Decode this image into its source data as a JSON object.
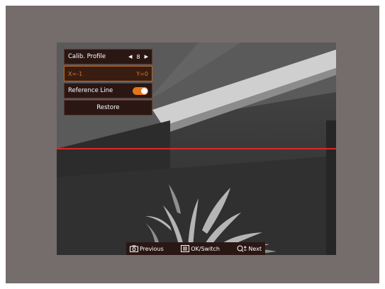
{
  "menu": {
    "calib_profile": {
      "label": "Calib. Profile",
      "value": "8"
    },
    "coords": {
      "x_text": "X=-1",
      "y_text": "Y=0"
    },
    "reference_line": {
      "label": "Reference Line",
      "enabled": true
    },
    "restore": {
      "label": "Restore"
    }
  },
  "hint_bar": {
    "previous": {
      "icon": "camera-icon",
      "label": "Previous"
    },
    "ok_switch": {
      "icon": "menu-icon",
      "label": "OK/Switch"
    },
    "next": {
      "icon": "zoom-icon",
      "label": "Next"
    }
  },
  "colors": {
    "reference_line": "#e0262b",
    "accent": "#e07818",
    "menu_bg": "#2a1714",
    "frame": "#746d6b"
  }
}
